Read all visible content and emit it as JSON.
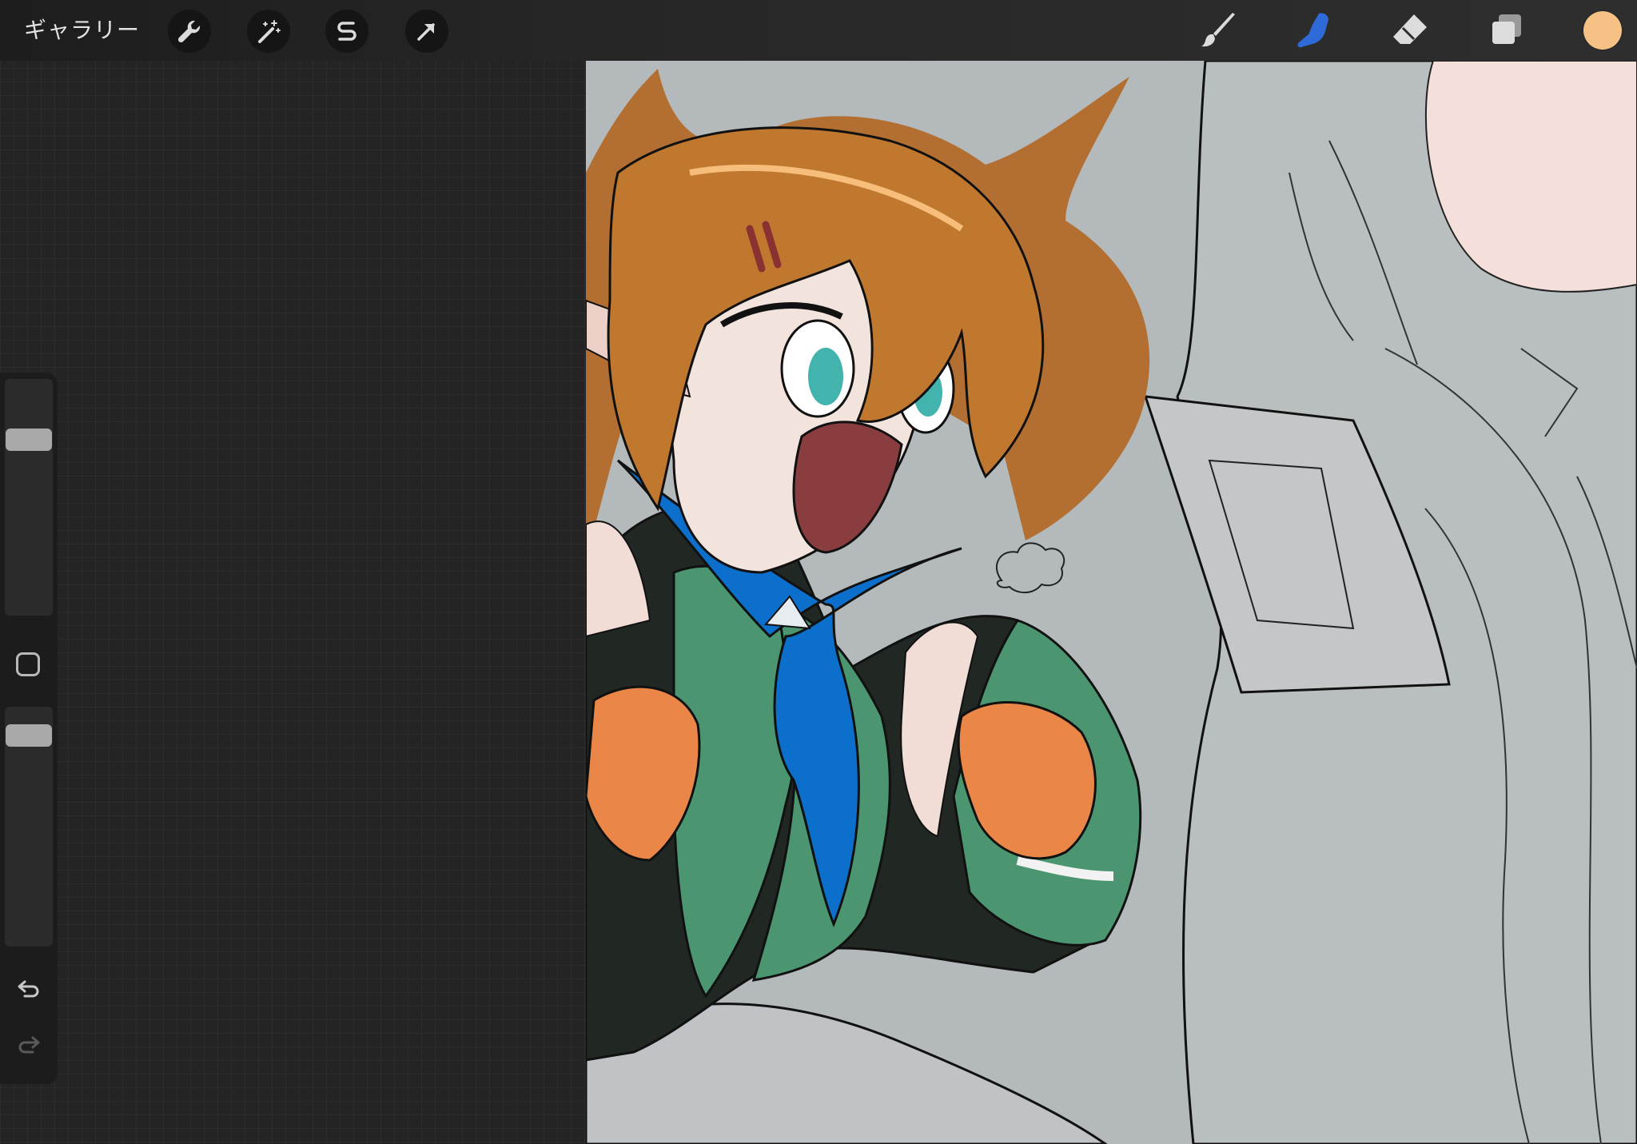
{
  "toolbar": {
    "gallery_label": "ギャラリー",
    "left_tools": [
      {
        "name": "actions",
        "icon": "wrench-icon"
      },
      {
        "name": "adjustments",
        "icon": "magic-wand-icon"
      },
      {
        "name": "selection",
        "icon": "selection-s-icon"
      },
      {
        "name": "transform",
        "icon": "arrow-cursor-icon"
      }
    ],
    "right_tools": [
      {
        "name": "brush",
        "icon": "brush-icon",
        "active": false
      },
      {
        "name": "smudge",
        "icon": "smudge-finger-icon",
        "active": true
      },
      {
        "name": "eraser",
        "icon": "eraser-icon",
        "active": false
      },
      {
        "name": "layers",
        "icon": "layers-icon",
        "active": false
      }
    ],
    "current_color": "#f5c185",
    "active_color": "#2f6bd8"
  },
  "sidebar": {
    "brush_size_level": 0.22,
    "opacity_level": 0.08,
    "modify_button_icon": "square-icon",
    "undo_icon": "undo-icon",
    "redo_icon": "redo-icon"
  },
  "canvas": {
    "background_color": "#b4b9bb",
    "content": "illustration-in-progress"
  }
}
